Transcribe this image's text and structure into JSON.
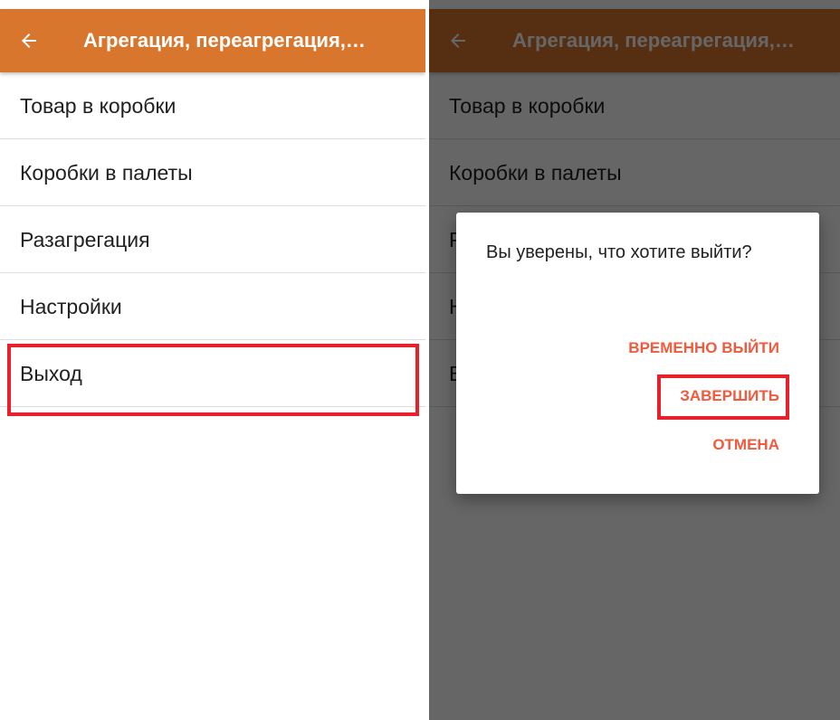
{
  "app": {
    "title": "Агрегация, переагрегация,…"
  },
  "menu": {
    "items": [
      {
        "label": "Товар в коробки"
      },
      {
        "label": "Коробки в палеты"
      },
      {
        "label": "Разагрегация"
      },
      {
        "label": "Настройки"
      },
      {
        "label": "Выход"
      }
    ]
  },
  "dialog": {
    "message": "Вы уверены, что хотите выйти?",
    "buttons": {
      "temporary_exit": "ВРЕМЕННО ВЫЙТИ",
      "finish": "ЗАВЕРШИТЬ",
      "cancel": "ОТМЕНА"
    }
  },
  "icons": {
    "back": "arrow-left-icon"
  },
  "colors": {
    "appbar": "#d8762e",
    "dialog_button": "#f15a3c",
    "highlight": "#e8202a"
  }
}
